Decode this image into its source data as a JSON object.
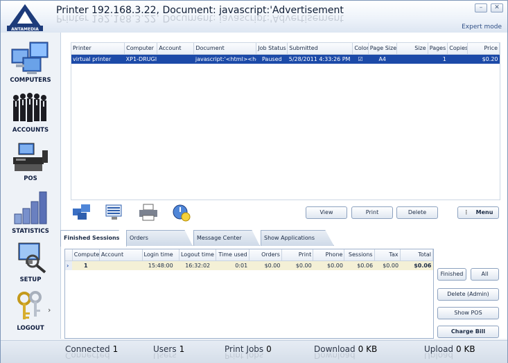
{
  "window": {
    "title": "Printer 192.168.3.22, Document:  javascript:'Advertisement",
    "logo_text": "ANTAMEDIA",
    "minimize": "–",
    "close": "✕",
    "mode": "Expert mode"
  },
  "nav": [
    {
      "label": "COMPUTERS",
      "icon": "computers-icon"
    },
    {
      "label": "ACCOUNTS",
      "icon": "accounts-icon"
    },
    {
      "label": "POS",
      "icon": "pos-icon"
    },
    {
      "label": "STATISTICS",
      "icon": "statistics-icon"
    },
    {
      "label": "SETUP",
      "icon": "setup-icon"
    },
    {
      "label": "LOGOUT",
      "icon": "keys-icon"
    }
  ],
  "nav_more": "›",
  "jobs": {
    "columns": [
      "Printer",
      "Computer",
      "Account",
      "Document",
      "Job Status",
      "Submitted",
      "Color",
      "Page Size",
      "Size",
      "Pages",
      "Copies",
      "Price"
    ],
    "rows": [
      {
        "printer": "virtual printer",
        "computer": "XP1-DRUGI",
        "account": "",
        "document": "javascript:'<html><hea",
        "status": "Paused",
        "submitted": "5/28/2011 4:33:26 PM",
        "color": "☑",
        "page_size": "A4",
        "size": "",
        "pages": "1",
        "copies": "",
        "price": "$0.20"
      }
    ]
  },
  "actions": {
    "view": "View",
    "print": "Print",
    "delete": "Delete",
    "menu": "Menu"
  },
  "tabs": [
    "Finished Sessions",
    "Orders",
    "Message Center",
    "Show Applications"
  ],
  "sessions": {
    "columns": [
      "Computer",
      "Account",
      "Login time",
      "Logout time",
      "Time used",
      "Orders",
      "Print",
      "Phone",
      "Sessions",
      "Tax",
      "Total"
    ],
    "rows": [
      {
        "marker": "›",
        "computer": "1",
        "account": "",
        "login": "15:48:00",
        "logout": "16:32:02",
        "used": "0:01",
        "orders": "$0.00",
        "print": "$0.00",
        "phone": "$0.00",
        "sessions": "$0.06",
        "tax": "$0.00",
        "total": "$0.06"
      }
    ]
  },
  "side_buttons": {
    "finished": "Finished",
    "all": "All",
    "delete_admin": "Delete (Admin)",
    "show_pos": "Show POS",
    "charge_bill": "Charge Bill"
  },
  "status": {
    "connected_label": "Connected",
    "connected": "1",
    "users_label": "Users",
    "users": "1",
    "jobs_label": "Print Jobs",
    "jobs": "0",
    "download_label": "Download",
    "download": "0 KB",
    "upload_label": "Upload",
    "upload": "0 KB"
  },
  "colors": {
    "selection": "#1c4aa8",
    "session_row": "#f4f0d6",
    "accent": "#2f4f86"
  }
}
